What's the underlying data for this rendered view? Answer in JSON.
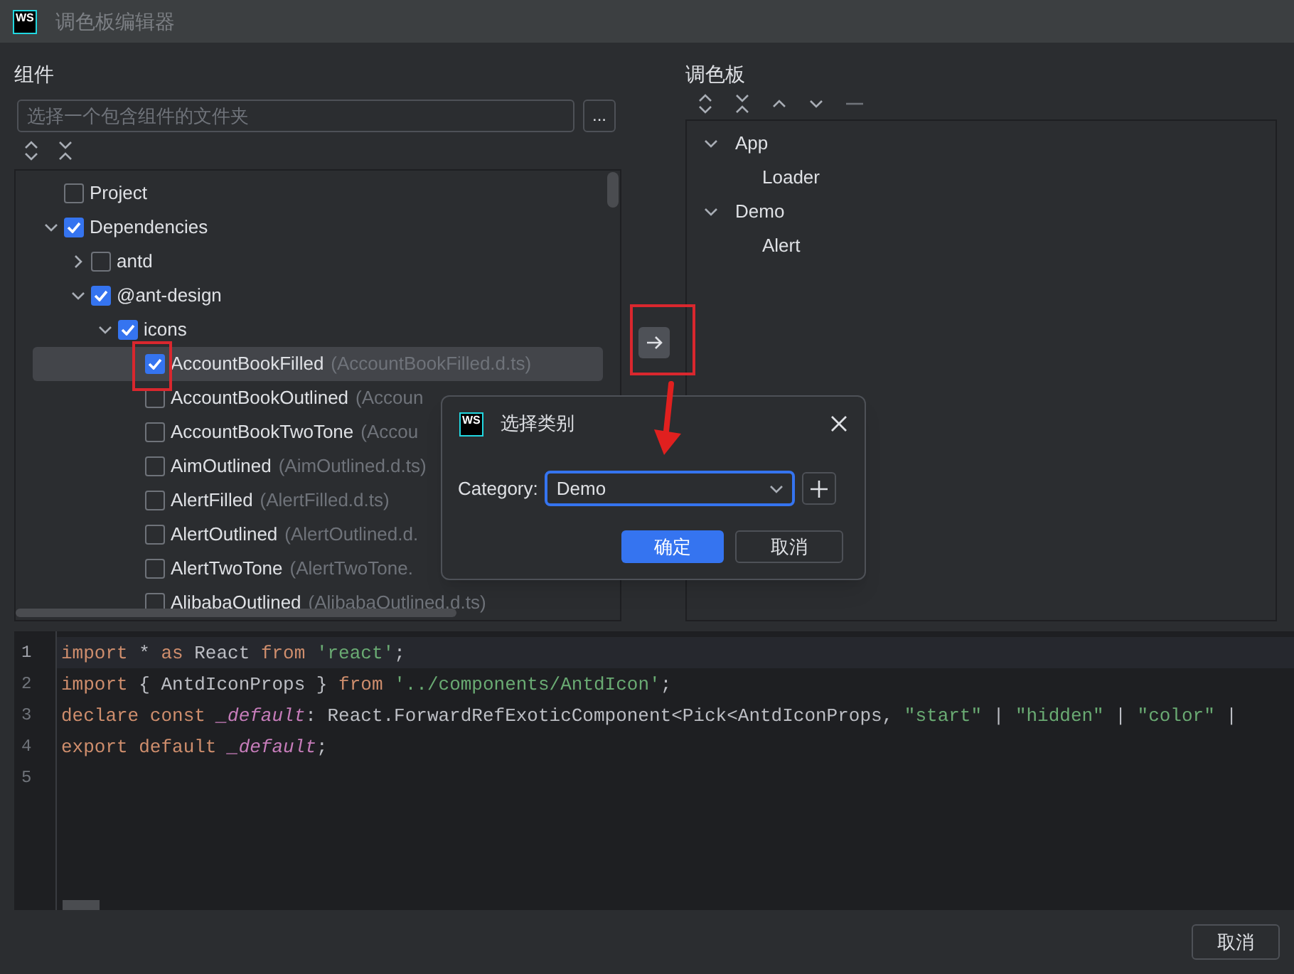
{
  "window": {
    "logo": "WS",
    "title": "调色板编辑器"
  },
  "components_panel": {
    "title": "组件",
    "folder_field": {
      "placeholder": "选择一个包含组件的文件夹"
    },
    "browse_button": "...",
    "tree": [
      {
        "label": "Project",
        "checked": false,
        "selected": false
      },
      {
        "label": "Dependencies",
        "checked": true,
        "selected": false,
        "expanded": true,
        "children": [
          {
            "label": "antd",
            "checked": false,
            "selected": false,
            "expanded": false
          },
          {
            "label": "@ant-design",
            "checked": true,
            "selected": false,
            "expanded": true,
            "children": [
              {
                "label": "icons",
                "checked": true,
                "selected": false,
                "expanded": true,
                "children": [
                  {
                    "label": "AccountBookFilled",
                    "file": "(AccountBookFilled.d.ts)",
                    "checked": true,
                    "selected": true
                  },
                  {
                    "label": "AccountBookOutlined",
                    "file": "(Accoun",
                    "checked": false,
                    "selected": false
                  },
                  {
                    "label": "AccountBookTwoTone",
                    "file": "(Accou",
                    "checked": false,
                    "selected": false
                  },
                  {
                    "label": "AimOutlined",
                    "file": "(AimOutlined.d.ts)",
                    "checked": false,
                    "selected": false
                  },
                  {
                    "label": "AlertFilled",
                    "file": "(AlertFilled.d.ts)",
                    "checked": false,
                    "selected": false
                  },
                  {
                    "label": "AlertOutlined",
                    "file": "(AlertOutlined.d.",
                    "checked": false,
                    "selected": false
                  },
                  {
                    "label": "AlertTwoTone",
                    "file": "(AlertTwoTone.",
                    "checked": false,
                    "selected": false
                  },
                  {
                    "label": "AlibabaOutlined",
                    "file": "(AlibabaOutlined.d.ts)",
                    "checked": false,
                    "selected": false
                  }
                ]
              }
            ]
          }
        ]
      }
    ]
  },
  "palette_panel": {
    "title": "调色板",
    "tree": [
      {
        "label": "App",
        "expanded": true,
        "children": [
          {
            "label": "Loader"
          }
        ]
      },
      {
        "label": "Demo",
        "expanded": true,
        "children": [
          {
            "label": "Alert"
          }
        ]
      }
    ]
  },
  "code_editor": {
    "lines": [
      {
        "number": "1",
        "current": true,
        "tokens": [
          {
            "kind": "keyword",
            "text": "import"
          },
          {
            "kind": "plain",
            "text": " * "
          },
          {
            "kind": "keyword",
            "text": "as"
          },
          {
            "kind": "plain",
            "text": " React "
          },
          {
            "kind": "keyword",
            "text": "from"
          },
          {
            "kind": "string",
            "text": " 'react'"
          },
          {
            "kind": "plain",
            "text": ";"
          }
        ]
      },
      {
        "number": "2",
        "current": false,
        "tokens": [
          {
            "kind": "keyword",
            "text": "import"
          },
          {
            "kind": "plain",
            "text": " { AntdIconProps } "
          },
          {
            "kind": "keyword",
            "text": "from"
          },
          {
            "kind": "string",
            "text": " '../components/AntdIcon'"
          },
          {
            "kind": "plain",
            "text": ";"
          }
        ]
      },
      {
        "number": "3",
        "current": false,
        "tokens": [
          {
            "kind": "keyword",
            "text": "declare const"
          },
          {
            "kind": "italic",
            "text": " _default"
          },
          {
            "kind": "plain",
            "text": ": React.ForwardRefExoticComponent<Pick<AntdIconProps, "
          },
          {
            "kind": "string",
            "text": "\"start\""
          },
          {
            "kind": "plain",
            "text": " | "
          },
          {
            "kind": "string",
            "text": "\"hidden\""
          },
          {
            "kind": "plain",
            "text": " | "
          },
          {
            "kind": "string",
            "text": "\"color\""
          },
          {
            "kind": "plain",
            "text": " |"
          }
        ]
      },
      {
        "number": "4",
        "current": false,
        "tokens": [
          {
            "kind": "keyword",
            "text": "export default"
          },
          {
            "kind": "italic",
            "text": " _default"
          },
          {
            "kind": "plain",
            "text": ";"
          }
        ]
      },
      {
        "number": "5",
        "current": false
      }
    ]
  },
  "dialog": {
    "logo": "WS",
    "title": "选择类别",
    "category_label": "Category:",
    "category_value": "Demo",
    "ok_button": "确定",
    "cancel_button": "取消"
  },
  "footer_buttons": [
    "取消"
  ]
}
